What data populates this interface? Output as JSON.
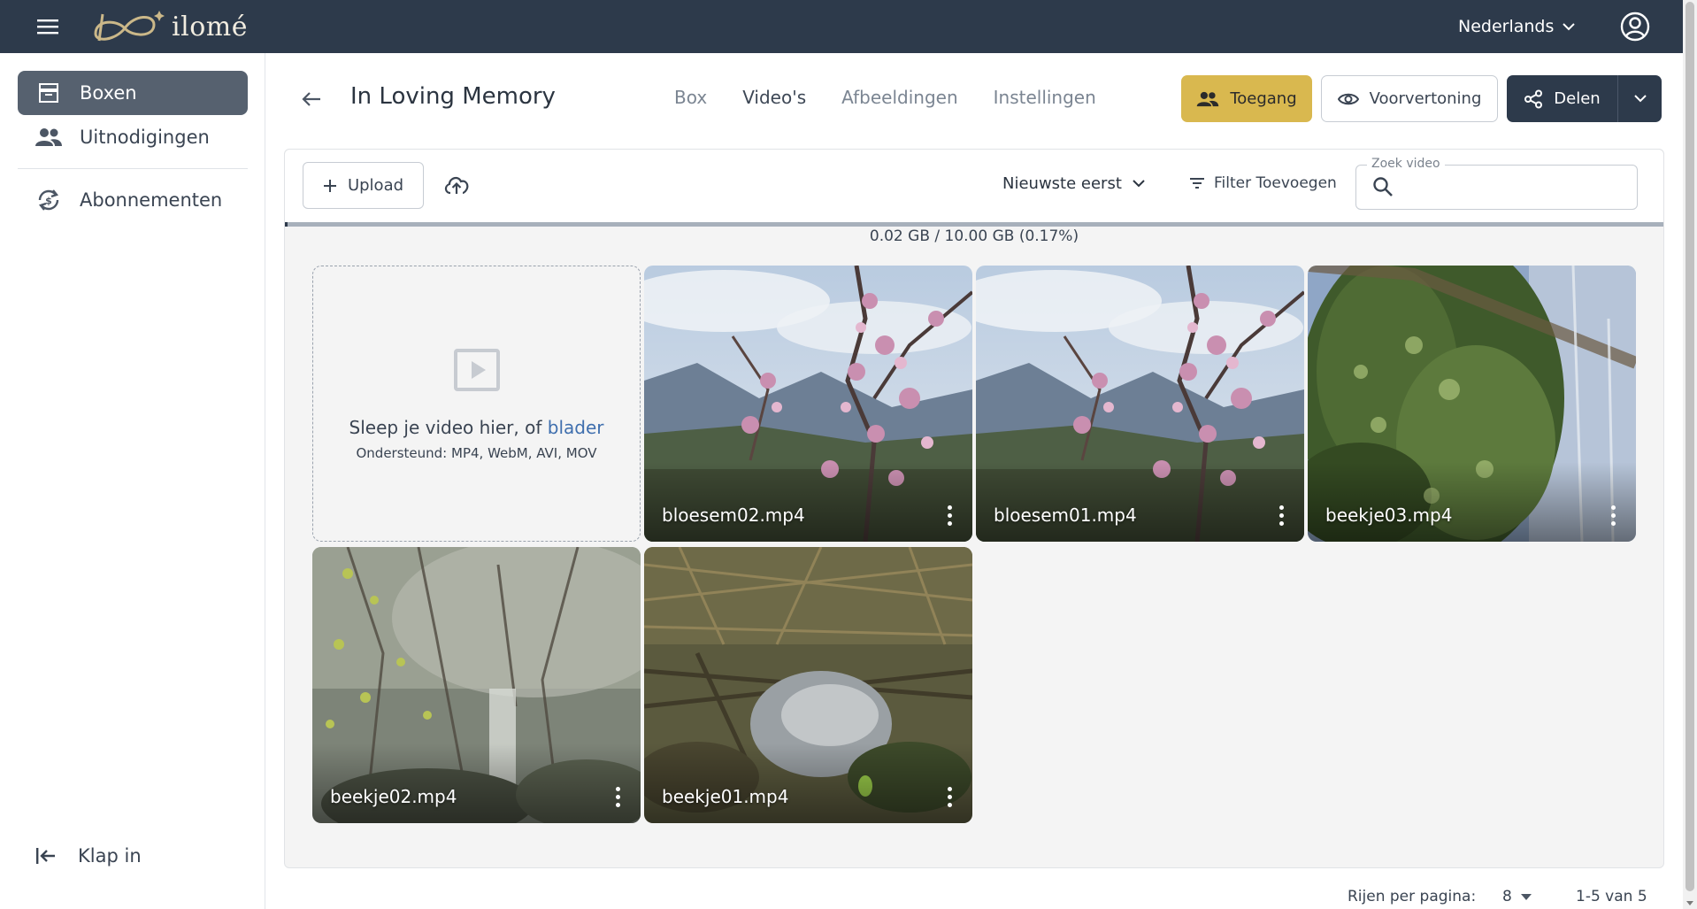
{
  "app": {
    "logo_text": "ilomé",
    "language": "Nederlands"
  },
  "sidebar": {
    "items": [
      {
        "label": "Boxen",
        "icon": "archive-icon",
        "active": true
      },
      {
        "label": "Uitnodigingen",
        "icon": "people-icon",
        "active": false
      },
      {
        "label": "Abonnementen",
        "icon": "subscription-icon",
        "active": false
      }
    ],
    "collapse_label": "Klap in"
  },
  "header": {
    "title": "In Loving Memory",
    "tabs": [
      {
        "label": "Box",
        "active": false
      },
      {
        "label": "Video's",
        "active": true
      },
      {
        "label": "Afbeeldingen",
        "active": false
      },
      {
        "label": "Instellingen",
        "active": false
      }
    ],
    "access_label": "Toegang",
    "preview_label": "Voorvertoning",
    "share_label": "Delen"
  },
  "toolbar": {
    "upload_label": "Upload",
    "sort_label": "Nieuwste eerst",
    "filter_label": "Filter Toevoegen",
    "search_label": "Zoek video",
    "search_value": ""
  },
  "storage": {
    "text": "0.02 GB / 10.00 GB (0.17%)",
    "used_fraction": 0.0017
  },
  "dropzone": {
    "text_prefix": "Sleep je video hier, of ",
    "link_text": "blader",
    "supported": "Ondersteund: MP4, WebM, AVI, MOV"
  },
  "videos": [
    {
      "name": "bloesem02.mp4",
      "thumb": "blossom"
    },
    {
      "name": "bloesem01.mp4",
      "thumb": "blossom"
    },
    {
      "name": "beekje03.mp4",
      "thumb": "trees"
    },
    {
      "name": "beekje02.mp4",
      "thumb": "stream"
    },
    {
      "name": "beekje01.mp4",
      "thumb": "reeds"
    }
  ],
  "pagination": {
    "rows_label": "Rijen per pagina:",
    "rows_value": "8",
    "range": "1-5 van 5"
  },
  "colors": {
    "topbar": "#2d3a4b",
    "accent_gold": "#d9b84f",
    "link_blue": "#3f6fae",
    "sidebar_active": "#56616f"
  }
}
